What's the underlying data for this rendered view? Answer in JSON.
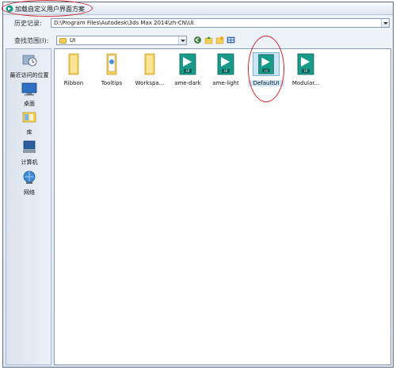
{
  "window": {
    "title": "加载自定义用户界面方案"
  },
  "history": {
    "label": "历史记录:",
    "value": "D:\\Program Files\\Autodesk\\3ds Max 2014\\zh-CN\\UI"
  },
  "lookin": {
    "label": "查找范围(I):",
    "value": "UI"
  },
  "toolbar": {
    "icons": [
      "back-icon",
      "up-folder-icon",
      "new-folder-icon",
      "view-menu-icon"
    ]
  },
  "places": [
    {
      "label": "最近访问的位置",
      "icon": "recent-places-icon"
    },
    {
      "label": "桌面",
      "icon": "desktop-icon"
    },
    {
      "label": "库",
      "icon": "libraries-icon"
    },
    {
      "label": "计算机",
      "icon": "computer-icon"
    },
    {
      "label": "网络",
      "icon": "network-icon"
    }
  ],
  "files": [
    {
      "name": "Ribbon",
      "type": "folder"
    },
    {
      "name": "Tooltips",
      "type": "folder-doc"
    },
    {
      "name": "Workspa...",
      "type": "folder"
    },
    {
      "name": "ame-dark",
      "type": "ui-file"
    },
    {
      "name": "ame-light",
      "type": "ui-file"
    },
    {
      "name": "DefaultUI",
      "type": "ui-file",
      "selected": true
    },
    {
      "name": "Modular...",
      "type": "ui-file"
    }
  ],
  "ui_badge": "UI",
  "colors": {
    "annotation_red": "#d1242a",
    "teal_icon": "#1a9a8a",
    "folder_yellow": "#f2cf57"
  }
}
